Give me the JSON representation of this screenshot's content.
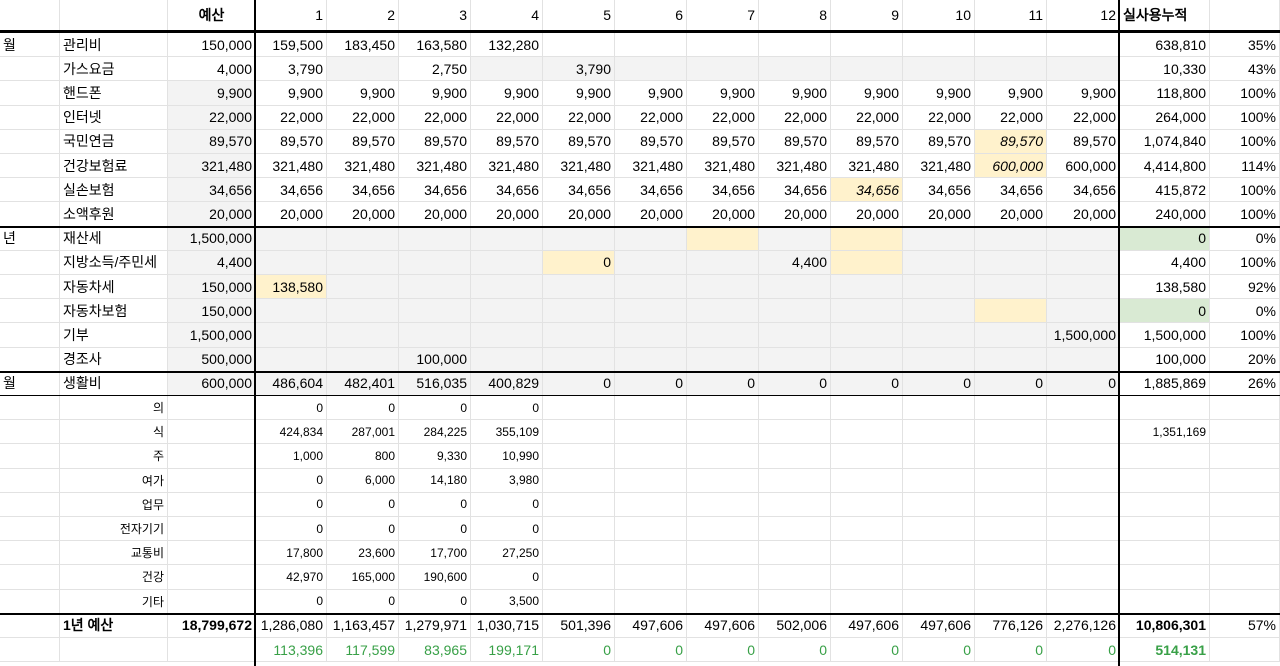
{
  "sheet": {
    "header": [
      "",
      "",
      "예산",
      "1",
      "2",
      "3",
      "4",
      "5",
      "6",
      "7",
      "8",
      "9",
      "10",
      "11",
      "12",
      "실사용누적",
      ""
    ],
    "rows": [
      {
        "c": [
          "월",
          "관리비",
          "150,000",
          "159,500",
          "183,450",
          "163,580",
          "132,280",
          "",
          "",
          "",
          "",
          "",
          "",
          "",
          "",
          "638,810",
          "35%"
        ]
      },
      {
        "c": [
          "",
          "가스요금",
          "4,000",
          "3,790",
          "",
          "2,750",
          "",
          "3,790",
          "",
          "",
          "",
          "",
          "",
          "",
          "",
          "10,330",
          "43%"
        ]
      },
      {
        "c": [
          "",
          "핸드폰",
          "9,900",
          "9,900",
          "9,900",
          "9,900",
          "9,900",
          "9,900",
          "9,900",
          "9,900",
          "9,900",
          "9,900",
          "9,900",
          "9,900",
          "9,900",
          "118,800",
          "100%"
        ]
      },
      {
        "c": [
          "",
          "인터넷",
          "22,000",
          "22,000",
          "22,000",
          "22,000",
          "22,000",
          "22,000",
          "22,000",
          "22,000",
          "22,000",
          "22,000",
          "22,000",
          "22,000",
          "22,000",
          "264,000",
          "100%"
        ]
      },
      {
        "c": [
          "",
          "국민연금",
          "89,570",
          "89,570",
          "89,570",
          "89,570",
          "89,570",
          "89,570",
          "89,570",
          "89,570",
          "89,570",
          "89,570",
          "89,570",
          "89,570",
          "89,570",
          "1,074,840",
          "100%"
        ]
      },
      {
        "c": [
          "",
          "건강보험료",
          "321,480",
          "321,480",
          "321,480",
          "321,480",
          "321,480",
          "321,480",
          "321,480",
          "321,480",
          "321,480",
          "321,480",
          "321,480",
          "600,000",
          "600,000",
          "4,414,800",
          "114%"
        ]
      },
      {
        "c": [
          "",
          "실손보험",
          "34,656",
          "34,656",
          "34,656",
          "34,656",
          "34,656",
          "34,656",
          "34,656",
          "34,656",
          "34,656",
          "34,656",
          "34,656",
          "34,656",
          "34,656",
          "415,872",
          "100%"
        ]
      },
      {
        "c": [
          "",
          "소액후원",
          "20,000",
          "20,000",
          "20,000",
          "20,000",
          "20,000",
          "20,000",
          "20,000",
          "20,000",
          "20,000",
          "20,000",
          "20,000",
          "20,000",
          "20,000",
          "240,000",
          "100%"
        ]
      },
      {
        "c": [
          "년",
          "재산세",
          "1,500,000",
          "",
          "",
          "",
          "",
          "",
          "",
          "",
          "",
          "",
          "",
          "",
          "",
          "0",
          "0%"
        ]
      },
      {
        "c": [
          "",
          "지방소득/주민세",
          "4,400",
          "",
          "",
          "",
          "",
          "0",
          "",
          "",
          "4,400",
          "",
          "",
          "",
          "",
          "4,400",
          "100%"
        ]
      },
      {
        "c": [
          "",
          "자동차세",
          "150,000",
          "138,580",
          "",
          "",
          "",
          "",
          "",
          "",
          "",
          "",
          "",
          "",
          "",
          "138,580",
          "92%"
        ]
      },
      {
        "c": [
          "",
          "자동차보험",
          "150,000",
          "",
          "",
          "",
          "",
          "",
          "",
          "",
          "",
          "",
          "",
          "",
          "",
          "0",
          "0%"
        ]
      },
      {
        "c": [
          "",
          "기부",
          "1,500,000",
          "",
          "",
          "",
          "",
          "",
          "",
          "",
          "",
          "",
          "",
          "",
          "1,500,000",
          "1,500,000",
          "100%"
        ]
      },
      {
        "c": [
          "",
          "경조사",
          "500,000",
          "",
          "",
          "100,000",
          "",
          "",
          "",
          "",
          "",
          "",
          "",
          "",
          "",
          "100,000",
          "20%"
        ]
      },
      {
        "c": [
          "월",
          "생활비",
          "600,000",
          "486,604",
          "482,401",
          "516,035",
          "400,829",
          "0",
          "0",
          "0",
          "0",
          "0",
          "0",
          "0",
          "0",
          "1,885,869",
          "26%"
        ]
      },
      {
        "c": [
          "",
          "의",
          "",
          "0",
          "0",
          "0",
          "0",
          "",
          "",
          "",
          "",
          "",
          "",
          "",
          "",
          "",
          ""
        ]
      },
      {
        "c": [
          "",
          "식",
          "",
          "424,834",
          "287,001",
          "284,225",
          "355,109",
          "",
          "",
          "",
          "",
          "",
          "",
          "",
          "",
          "1,351,169",
          ""
        ]
      },
      {
        "c": [
          "",
          "주",
          "",
          "1,000",
          "800",
          "9,330",
          "10,990",
          "",
          "",
          "",
          "",
          "",
          "",
          "",
          "",
          "",
          ""
        ]
      },
      {
        "c": [
          "",
          "여가",
          "",
          "0",
          "6,000",
          "14,180",
          "3,980",
          "",
          "",
          "",
          "",
          "",
          "",
          "",
          "",
          "",
          ""
        ]
      },
      {
        "c": [
          "",
          "업무",
          "",
          "0",
          "0",
          "0",
          "0",
          "",
          "",
          "",
          "",
          "",
          "",
          "",
          "",
          "",
          ""
        ]
      },
      {
        "c": [
          "",
          "전자기기",
          "",
          "0",
          "0",
          "0",
          "0",
          "",
          "",
          "",
          "",
          "",
          "",
          "",
          "",
          "",
          ""
        ]
      },
      {
        "c": [
          "",
          "교통비",
          "",
          "17,800",
          "23,600",
          "17,700",
          "27,250",
          "",
          "",
          "",
          "",
          "",
          "",
          "",
          "",
          "",
          ""
        ]
      },
      {
        "c": [
          "",
          "건강",
          "",
          "42,970",
          "165,000",
          "190,600",
          "0",
          "",
          "",
          "",
          "",
          "",
          "",
          "",
          "",
          "",
          ""
        ]
      },
      {
        "c": [
          "",
          "기타",
          "",
          "0",
          "0",
          "0",
          "3,500",
          "",
          "",
          "",
          "",
          "",
          "",
          "",
          "",
          "",
          ""
        ]
      },
      {
        "c": [
          "",
          "1년 예산",
          "18,799,672",
          "1,286,080",
          "1,163,457",
          "1,279,971",
          "1,030,715",
          "501,396",
          "497,606",
          "497,606",
          "502,006",
          "497,606",
          "497,606",
          "776,126",
          "2,276,126",
          "10,806,301",
          "57%"
        ]
      },
      {
        "c": [
          "",
          "",
          "",
          "113,396",
          "117,599",
          "83,965",
          "199,171",
          "0",
          "0",
          "0",
          "0",
          "0",
          "0",
          "0",
          "0",
          "514,131",
          ""
        ]
      }
    ]
  }
}
